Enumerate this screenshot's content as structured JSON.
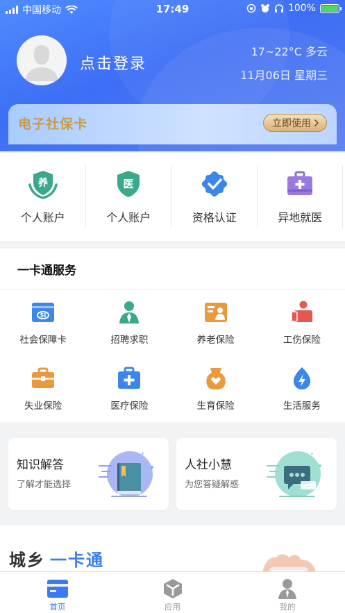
{
  "status_bar": {
    "carrier": "中国移动",
    "time": "17:49",
    "battery": "100%"
  },
  "header": {
    "login_text": "点击登录",
    "weather": "17~22°C 多云",
    "date": "11月06日 星期三"
  },
  "social_card": {
    "title": "电子社保卡",
    "button_label": "立即使用"
  },
  "quick_items": [
    {
      "label": "个人账户",
      "icon": "nurture-shield-icon",
      "badge": "养"
    },
    {
      "label": "个人账户",
      "icon": "medical-shield-icon",
      "badge": "医"
    },
    {
      "label": "资格认证",
      "icon": "certified-badge-icon"
    },
    {
      "label": "异地就医",
      "icon": "medical-kit-icon"
    }
  ],
  "services": {
    "title": "一卡通服务",
    "items": [
      {
        "label": "社会保障卡",
        "icon": "social-security-card-icon"
      },
      {
        "label": "招聘求职",
        "icon": "recruitment-icon"
      },
      {
        "label": "养老保险",
        "icon": "pension-icon"
      },
      {
        "label": "工伤保险",
        "icon": "work-injury-icon"
      },
      {
        "label": "失业保险",
        "icon": "unemployment-icon"
      },
      {
        "label": "医疗保险",
        "icon": "medical-insurance-icon"
      },
      {
        "label": "生育保险",
        "icon": "maternity-icon"
      },
      {
        "label": "生活服务",
        "icon": "life-service-icon"
      }
    ]
  },
  "cards": [
    {
      "title": "知识解答",
      "subtitle": "了解才能选择",
      "icon": "knowledge-book-icon"
    },
    {
      "title": "人社小慧",
      "subtitle": "为您答疑解惑",
      "icon": "chat-bubble-icon"
    }
  ],
  "banner": {
    "part1": "城乡",
    "part2": "一卡通"
  },
  "tabbar": [
    {
      "label": "首页",
      "icon": "home-card-icon",
      "active": true
    },
    {
      "label": "应用",
      "icon": "apps-cube-icon",
      "active": false
    },
    {
      "label": "我的",
      "icon": "profile-icon",
      "active": false
    }
  ],
  "colors": {
    "header_blue": "#4f8cff",
    "card_gold": "#c89c4f",
    "active_tab": "#3b7af0"
  }
}
